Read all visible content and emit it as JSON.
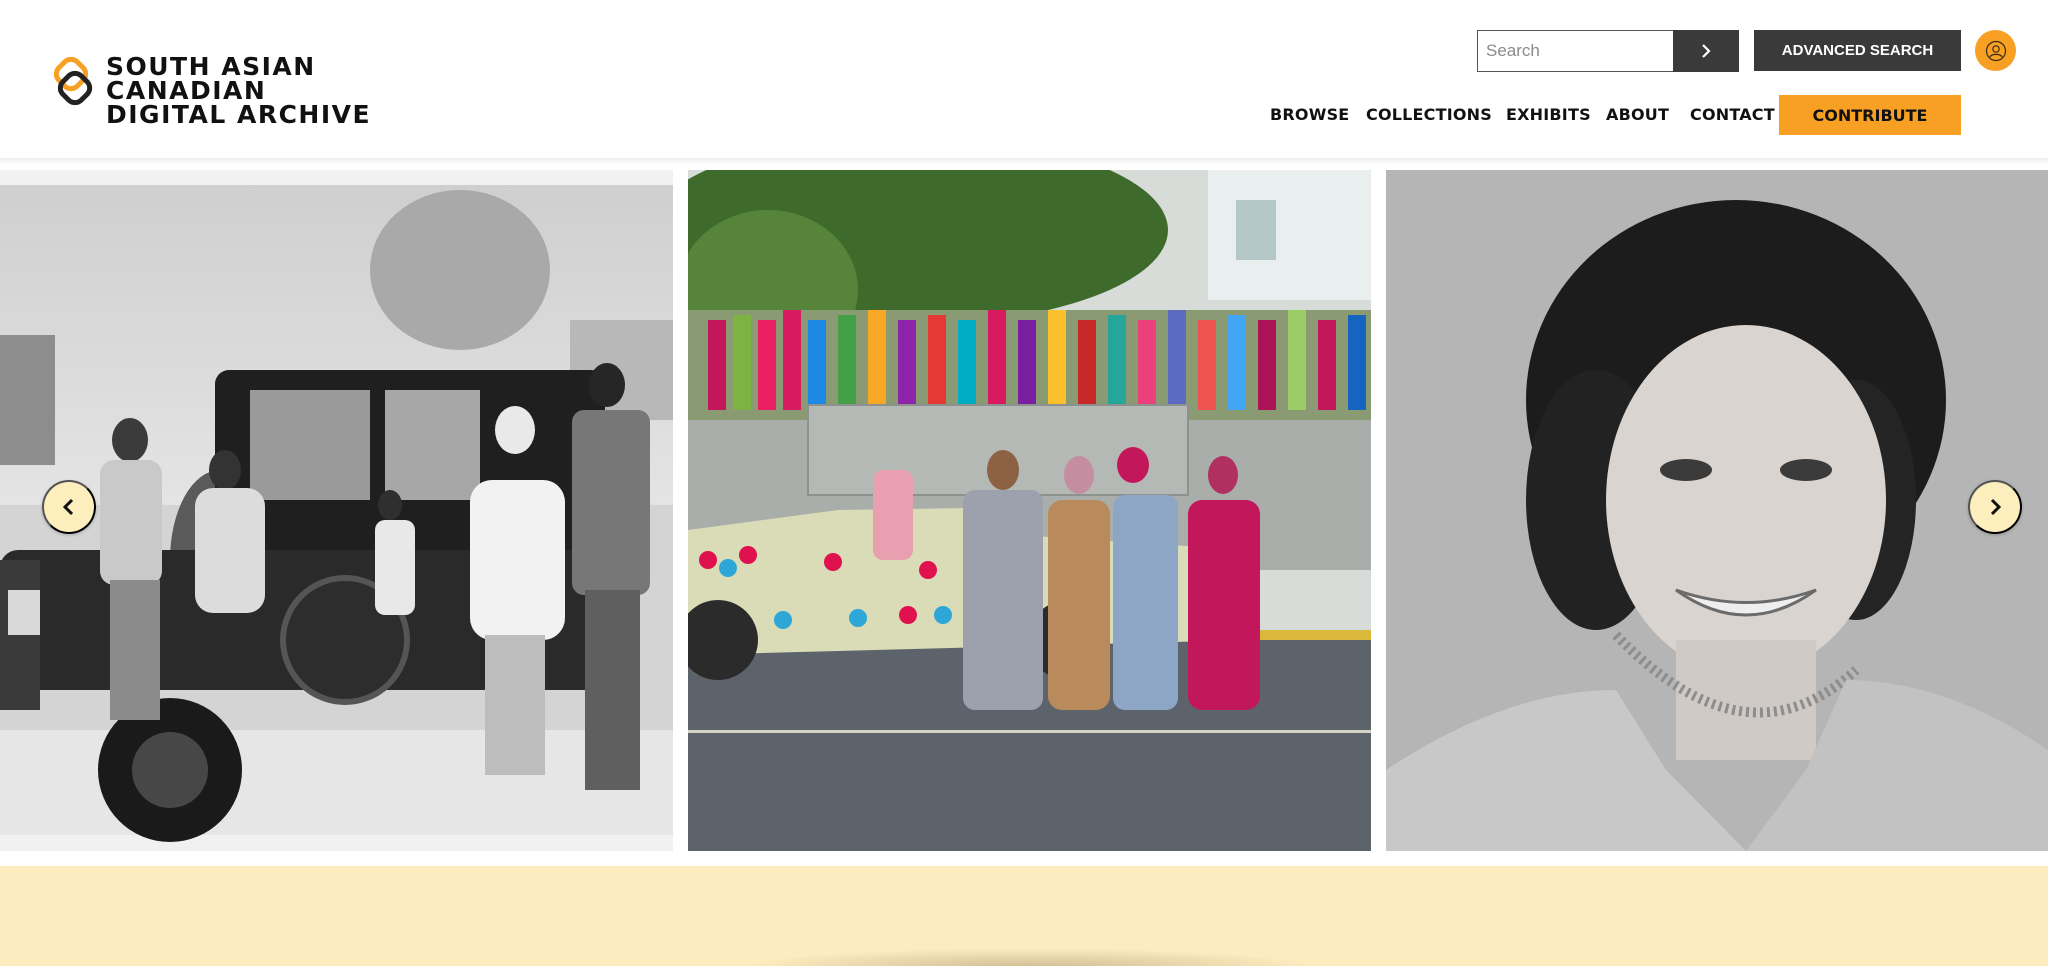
{
  "brand": {
    "logo_line1": "SOUTH ASIAN",
    "logo_line2": "CANADIAN",
    "logo_line3": "DIGITAL ARCHIVE",
    "logo_icon": "interlocked-rings-logo-icon",
    "accent_color": "#f7a023"
  },
  "search": {
    "placeholder": "Search",
    "value": "",
    "submit_icon": "chevron-right-icon",
    "advanced_label": "ADVANCED SEARCH"
  },
  "user": {
    "icon": "user-account-icon"
  },
  "nav": {
    "items": [
      {
        "label": "BROWSE"
      },
      {
        "label": "COLLECTIONS"
      },
      {
        "label": "EXHIBITS"
      },
      {
        "label": "ABOUT"
      },
      {
        "label": "CONTACT"
      }
    ],
    "contribute_label": "CONTRIBUTE"
  },
  "carousel": {
    "prev_icon": "chevron-left-icon",
    "next_icon": "chevron-right-icon",
    "slides": [
      {
        "kind": "black-and-white family photo with vintage car"
      },
      {
        "kind": "color photo of wedding party beside decorated car"
      },
      {
        "kind": "black-and-white portrait of a woman"
      }
    ]
  },
  "colors": {
    "dark_button": "#3a3a3a",
    "band": "#fdecc0",
    "arrow_bg": "#fdeebd"
  }
}
